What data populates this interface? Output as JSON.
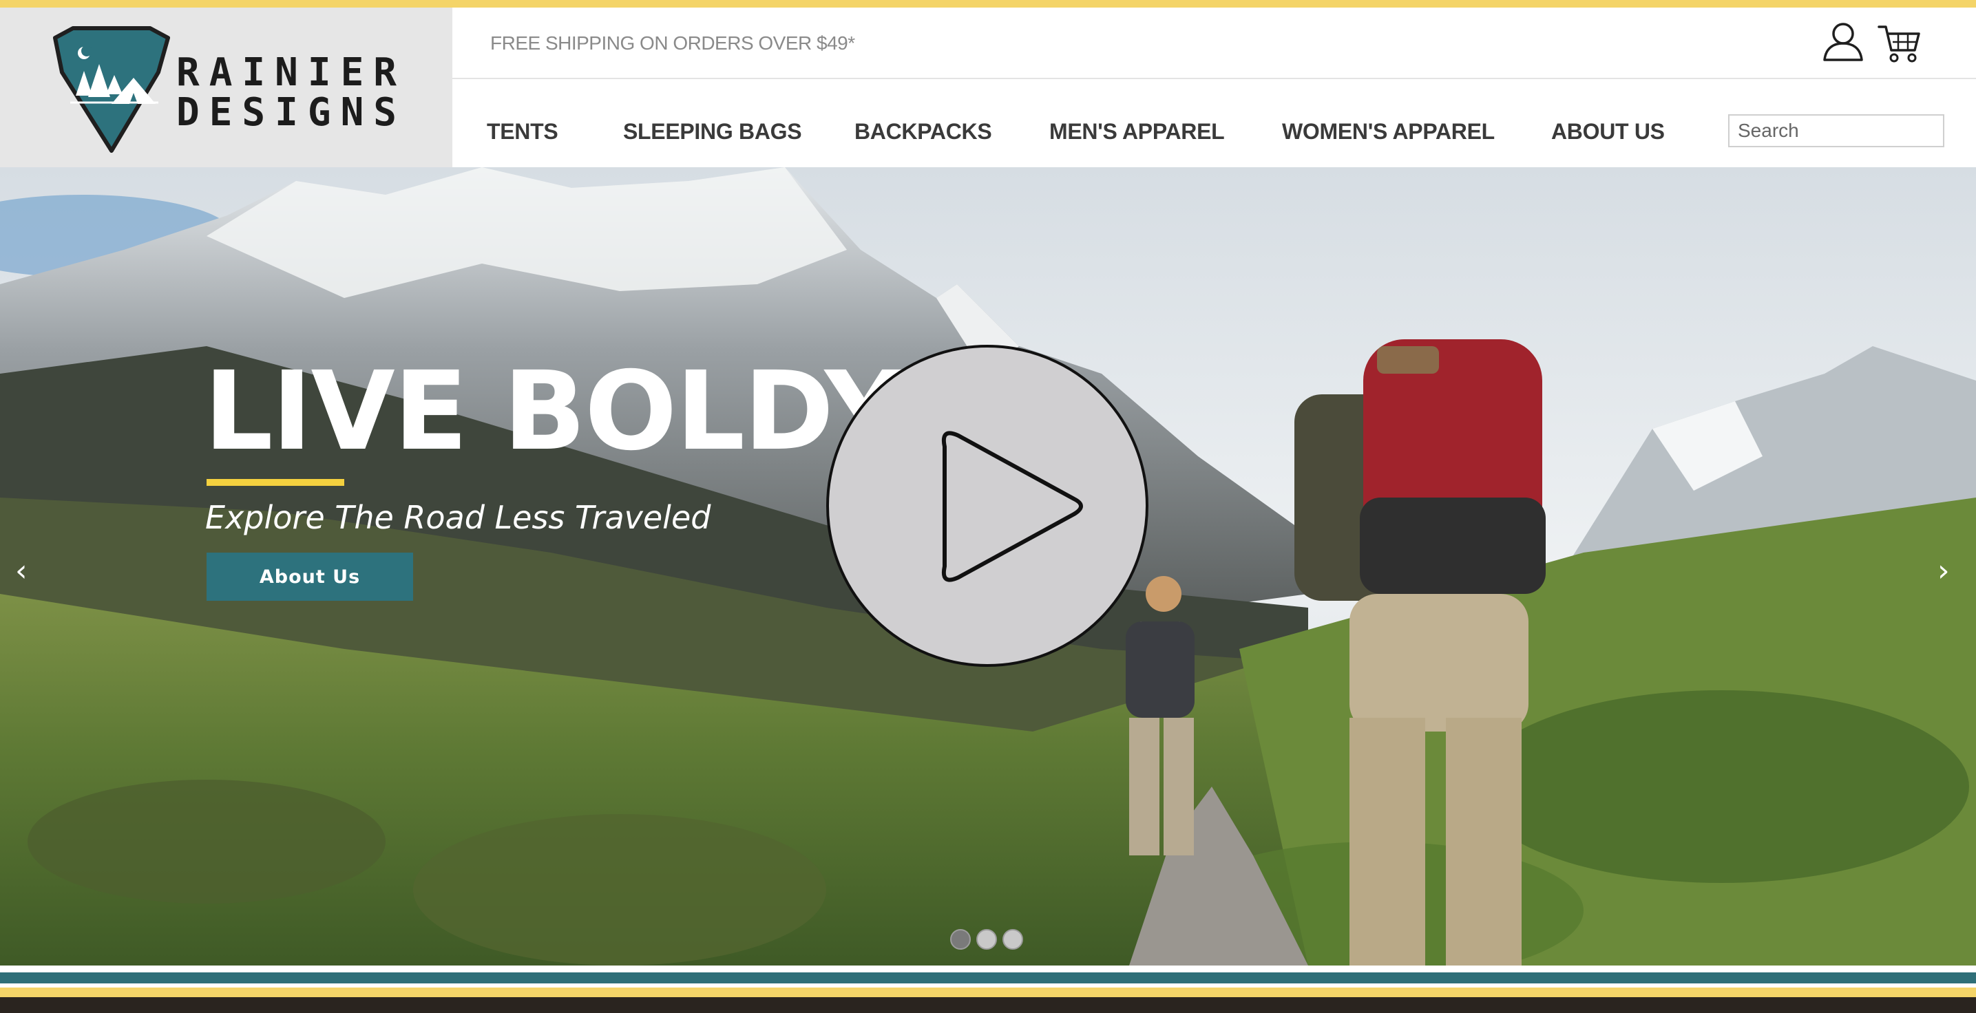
{
  "brand": {
    "name_line1": "RAINIER",
    "name_line2": "DESIGNS",
    "logo_icon": "mountain-tent-badge-icon",
    "colors": {
      "teal": "#2d727d",
      "yellow": "#f4d468",
      "dark": "#1c1c1c"
    }
  },
  "header": {
    "shipping_text": "FREE SHIPPING ON ORDERS OVER $49*",
    "account_icon": "user-icon",
    "cart_icon": "shopping-cart-icon"
  },
  "nav": {
    "items": [
      {
        "label": "TENTS"
      },
      {
        "label": "SLEEPING BAGS"
      },
      {
        "label": "BACKPACKS"
      },
      {
        "label": "MEN'S APPAREL"
      },
      {
        "label": "WOMEN'S APPAREL"
      },
      {
        "label": "ABOUT US"
      }
    ],
    "search_placeholder": "Search"
  },
  "hero": {
    "title": "LIVE BOLDY",
    "subtitle": "Explore The Road Less Traveled",
    "button_label": "About Us",
    "prev_arrow": "‹",
    "next_arrow": "›",
    "play_icon": "play-icon",
    "slide_count": 3,
    "active_slide": 1
  }
}
